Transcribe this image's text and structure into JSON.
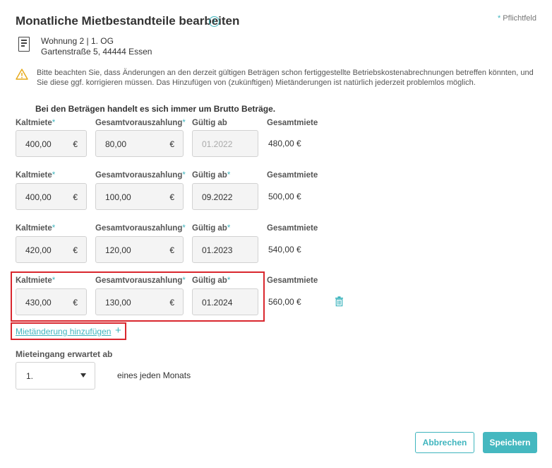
{
  "header": {
    "title": "Monatliche Mietbestandteile bearbeiten",
    "info_icon": "i",
    "required_star": "*",
    "required_label": "Pflichtfeld"
  },
  "property": {
    "icon": "document-icon",
    "line1": "Wohnung 2 | 1. OG",
    "line2": "Gartenstraße 5, 44444 Essen"
  },
  "warning": {
    "icon": "warning-icon",
    "text": "Bitte beachten Sie, dass Änderungen an den derzeit gültigen Beträgen schon fertiggestellte Betriebskostenabrechnungen betreffen könnten, und Sie diese ggf. korrigieren müssen. Das Hinzufügen von (zukünftigen) Mietänderungen ist natürlich jederzeit problemlos möglich."
  },
  "brutto_note": "Bei den Beträgen handelt es sich immer um Brutto Beträge.",
  "labels": {
    "kaltmiete": "Kaltmiete",
    "vorauszahlung": "Gesamtvorauszahlung",
    "gueltig": "Gültig ab",
    "gesamt": "Gesamtmiete",
    "star": "*",
    "currency": "€"
  },
  "rows": [
    {
      "kaltmiete": "400,00",
      "vorauszahlung": "80,00",
      "gueltig_ab": "01.2022",
      "gesamtmiete": "480,00 €"
    },
    {
      "kaltmiete": "400,00",
      "vorauszahlung": "100,00",
      "gueltig_ab": "09.2022",
      "gesamtmiete": "500,00 €"
    },
    {
      "kaltmiete": "420,00",
      "vorauszahlung": "120,00",
      "gueltig_ab": "01.2023",
      "gesamtmiete": "540,00 €"
    },
    {
      "kaltmiete": "430,00",
      "vorauszahlung": "130,00",
      "gueltig_ab": "01.2024",
      "gesamtmiete": "560,00 €"
    }
  ],
  "add_change": {
    "label": "Mietänderung hinzufügen",
    "icon": "plus-icon",
    "symbol": "+"
  },
  "payment": {
    "label": "Mieteingang erwartet ab",
    "selected": "1.",
    "suffix": "eines jeden Monats"
  },
  "buttons": {
    "cancel": "Abbrechen",
    "save": "Speichern"
  },
  "colors": {
    "accent": "#3fb5be",
    "highlight": "#d9272e",
    "warning": "#e6a817"
  }
}
